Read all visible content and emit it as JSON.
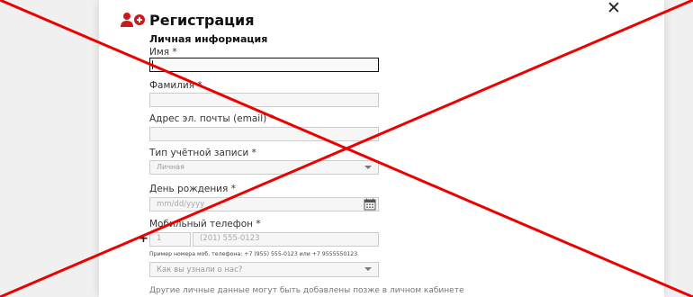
{
  "modal": {
    "title": "Регистрация",
    "section": "Личная информация",
    "close": "✕"
  },
  "fields": {
    "first_name": {
      "label": "Имя *",
      "value": ""
    },
    "last_name": {
      "label": "Фамилия *",
      "value": ""
    },
    "email": {
      "label": "Адрес эл. почты (email) *",
      "value": ""
    },
    "account_type": {
      "label": "Тип учётной записи *",
      "selected": "Личная"
    },
    "birthday": {
      "label": "День рождения *",
      "placeholder": "mm/dd/yyyy"
    },
    "mobile": {
      "label": "Мобильный телефон *",
      "plus": "+",
      "code_placeholder": "1",
      "number_placeholder": "(201) 555-0123",
      "hint": "Пример номера моб. телефона: +7 (955) 555-0123 или +7 9555550123"
    },
    "referral": {
      "selected": "Как вы узнали о нас?"
    }
  },
  "footer_note": "Другие личные данные могут быть добавлены позже в личном кабинете",
  "colors": {
    "accent": "#cc1a1a",
    "cross": "#ee0000",
    "input_border": "#cccccc",
    "input_bg": "#f6f6f6"
  },
  "icons": {
    "title": "add-user-icon",
    "close": "close-icon",
    "calendar": "calendar-icon",
    "dropdown": "chevron-down-icon"
  }
}
